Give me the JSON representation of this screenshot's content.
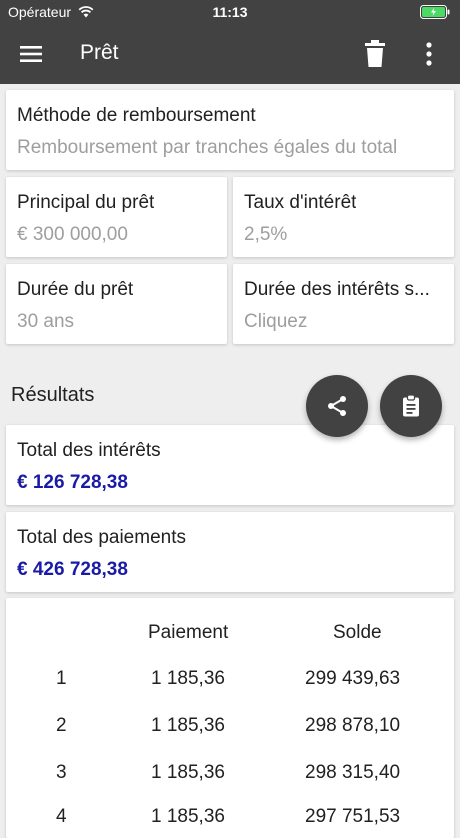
{
  "status": {
    "carrier": "Opérateur",
    "time": "11:13"
  },
  "appbar": {
    "title": "Prêt"
  },
  "method": {
    "label": "Méthode de remboursement",
    "value": "Remboursement par tranches égales du total"
  },
  "principal": {
    "label": "Principal du prêt",
    "value": "€ 300 000,00"
  },
  "rate": {
    "label": "Taux d'intérêt",
    "value": "2,5%"
  },
  "duration": {
    "label": "Durée du prêt",
    "value": "30 ans"
  },
  "interest_duration": {
    "label": "Durée des intérêts s...",
    "value": "Cliquez"
  },
  "results": {
    "title": "Résultats",
    "total_interest": {
      "label": "Total des intérêts",
      "value": "€ 126 728,38"
    },
    "total_payments": {
      "label": "Total des paiements",
      "value": "€ 426 728,38"
    }
  },
  "table": {
    "headers": {
      "payment": "Paiement",
      "balance": "Solde"
    },
    "rows": [
      {
        "n": "1",
        "payment": "1 185,36",
        "balance": "299 439,63"
      },
      {
        "n": "2",
        "payment": "1 185,36",
        "balance": "298 878,10"
      },
      {
        "n": "3",
        "payment": "1 185,36",
        "balance": "298 315,40"
      },
      {
        "n": "4",
        "payment": "1 185,36",
        "balance": "297 751,53"
      }
    ]
  },
  "colors": {
    "bar": "#424242",
    "result": "#1a1aa6",
    "muted": "#9e9e9e"
  },
  "icons": [
    "wifi-icon",
    "battery-icon",
    "menu-icon",
    "delete-icon",
    "more-icon",
    "share-icon",
    "clipboard-icon"
  ]
}
